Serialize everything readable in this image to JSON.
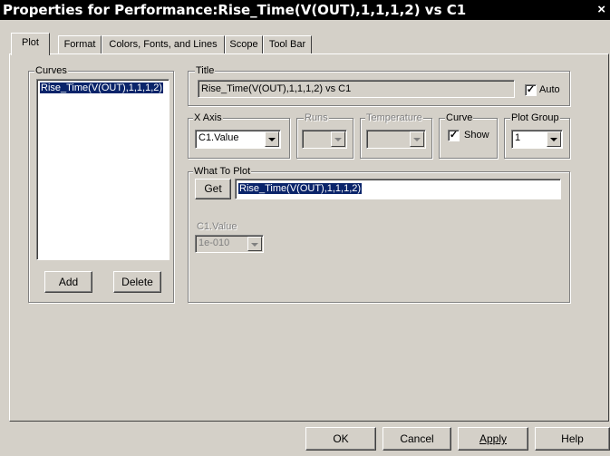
{
  "window": {
    "title": "Properties for Performance:Rise_Time(V(OUT),1,1,1,2) vs C1",
    "close_glyph": "×"
  },
  "tabs": [
    {
      "label": "Plot",
      "active": true
    },
    {
      "label": "Format",
      "active": false
    },
    {
      "label": "Colors, Fonts, and Lines",
      "active": false
    },
    {
      "label": "Scope",
      "active": false
    },
    {
      "label": "Tool Bar",
      "active": false
    }
  ],
  "curves": {
    "legend": "Curves",
    "items": [
      "Rise_Time(V(OUT),1,1,1,2)"
    ],
    "add_label": "Add",
    "delete_label": "Delete"
  },
  "title_group": {
    "legend": "Title",
    "value": "Rise_Time(V(OUT),1,1,1,2) vs C1",
    "auto_label": "Auto",
    "auto_checked": true
  },
  "x_axis": {
    "legend": "X Axis",
    "value": "C1.Value"
  },
  "runs": {
    "legend": "Runs",
    "value": ""
  },
  "temperature": {
    "legend": "Temperature",
    "value": ""
  },
  "curve": {
    "legend": "Curve",
    "show_label": "Show",
    "show_checked": true
  },
  "plot_group": {
    "legend": "Plot Group",
    "value": "1"
  },
  "what_to_plot": {
    "legend": "What To Plot",
    "get_label": "Get",
    "expression": "Rise_Time(V(OUT),1,1,1,2)",
    "param_label": "C1.Value",
    "param_value": "1e-010"
  },
  "footer": {
    "ok_label": "OK",
    "cancel_label": "Cancel",
    "apply_label": "Apply",
    "help_label": "Help"
  },
  "icons": {
    "check": "✓"
  },
  "colors": {
    "selection": "#0a246a",
    "titlebar": "#000000",
    "dialog": "#d4d0c8"
  }
}
